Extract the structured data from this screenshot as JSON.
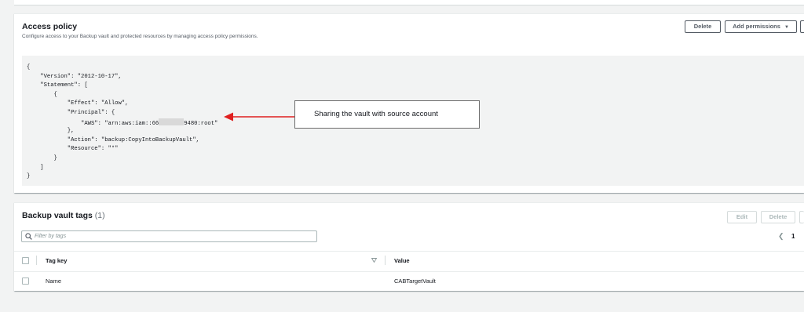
{
  "access_policy": {
    "title": "Access policy",
    "description": "Configure access to your Backup vault and protected resources by managing access policy permissions.",
    "delete_label": "Delete",
    "add_permissions_label": "Add permissions",
    "code_lines": [
      "{",
      "    \"Version\": \"2012-10-17\",",
      "    \"Statement\": [",
      "        {",
      "            \"Effect\": \"Allow\",",
      "            \"Principal\": {",
      "                \"AWS\": \"arn:aws:iam::66",
      "            },",
      "            \"Action\": \"backup:CopyIntoBackupVault\",",
      "            \"Resource\": \"*\"",
      "        }",
      "    ]",
      "}"
    ],
    "principal_suffix": "9480:root\"",
    "callout_text": "Sharing the vault with source account",
    "arrow_color": "#e02020"
  },
  "tags": {
    "title": "Backup vault tags",
    "count": "(1)",
    "edit_label": "Edit",
    "delete_label": "Delete",
    "filter_placeholder": "Filter by tags",
    "page_number": "1",
    "columns": {
      "key": "Tag key",
      "value": "Value"
    },
    "rows": [
      {
        "key": "Name",
        "value": "CABTargetVault"
      }
    ]
  }
}
